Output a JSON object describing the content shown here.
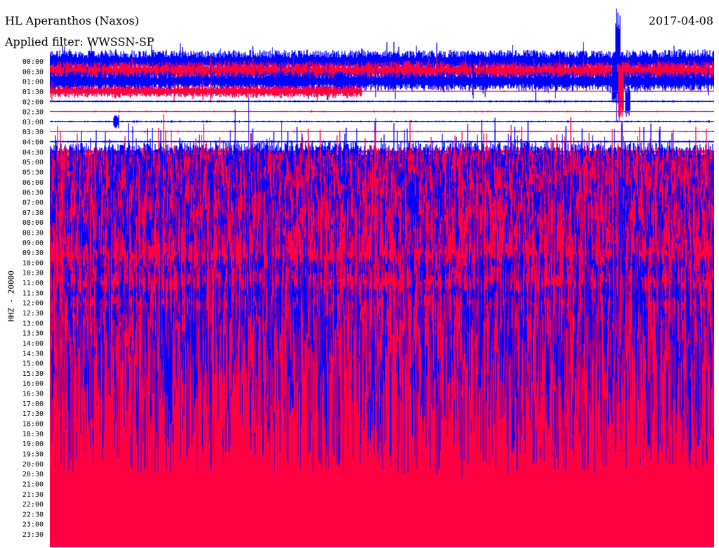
{
  "header": {
    "station": "HL Aperanthos (Naxos)",
    "date": "2017-04-08",
    "filter": "Applied filter: WWSSN-SP"
  },
  "chart_data": {
    "type": "line",
    "subtype": "helicorder",
    "title": "HL Aperanthos (Naxos)",
    "ylabel": "HHZ - 20000",
    "row_minutes": 30,
    "colors": {
      "even": "#0000ff",
      "odd": "#ff0040"
    },
    "row_labels": [
      "00:00",
      "00:30",
      "01:00",
      "01:30",
      "02:00",
      "02:30",
      "03:00",
      "03:30",
      "04:00",
      "04:30",
      "05:00",
      "05:30",
      "06:00",
      "06:30",
      "07:00",
      "07:30",
      "08:00",
      "08:30",
      "09:00",
      "09:30",
      "10:00",
      "10:30",
      "11:00",
      "11:30",
      "12:00",
      "12:30",
      "13:00",
      "13:30",
      "14:00",
      "14:30",
      "15:00",
      "15:30",
      "16:00",
      "16:30",
      "17:00",
      "17:30",
      "18:00",
      "18:30",
      "19:00",
      "19:30",
      "20:00",
      "20:30",
      "21:00",
      "21:30",
      "22:00",
      "22:30",
      "23:00",
      "23:30"
    ],
    "relative_amplitude": [
      1.1,
      1.0,
      1.0,
      0.6,
      0.08,
      0.06,
      0.08,
      0.06,
      0.08,
      0.15,
      2,
      2.5,
      3.5,
      4,
      4.5,
      5,
      5,
      5,
      5.5,
      5.5,
      5,
      5,
      3,
      3,
      2,
      2,
      2,
      2,
      3,
      4,
      4,
      5,
      6,
      7,
      8,
      9,
      10,
      11,
      12,
      14,
      20,
      20,
      20,
      20,
      20,
      20,
      20,
      20
    ],
    "quiet_after_fraction": {
      "row": 3,
      "fraction": 0.47,
      "amplitude": 0.05
    },
    "events": [
      {
        "row": 0,
        "fraction": 0.855,
        "amplitude": 6
      },
      {
        "row": 2,
        "fraction": 0.85,
        "amplitude": 2.5
      },
      {
        "row": 3,
        "fraction": 0.86,
        "amplitude": 3
      },
      {
        "row": 4,
        "fraction": 0.87,
        "amplitude": 1.5
      },
      {
        "row": 6,
        "fraction": 0.1,
        "amplitude": 0.7
      }
    ]
  }
}
